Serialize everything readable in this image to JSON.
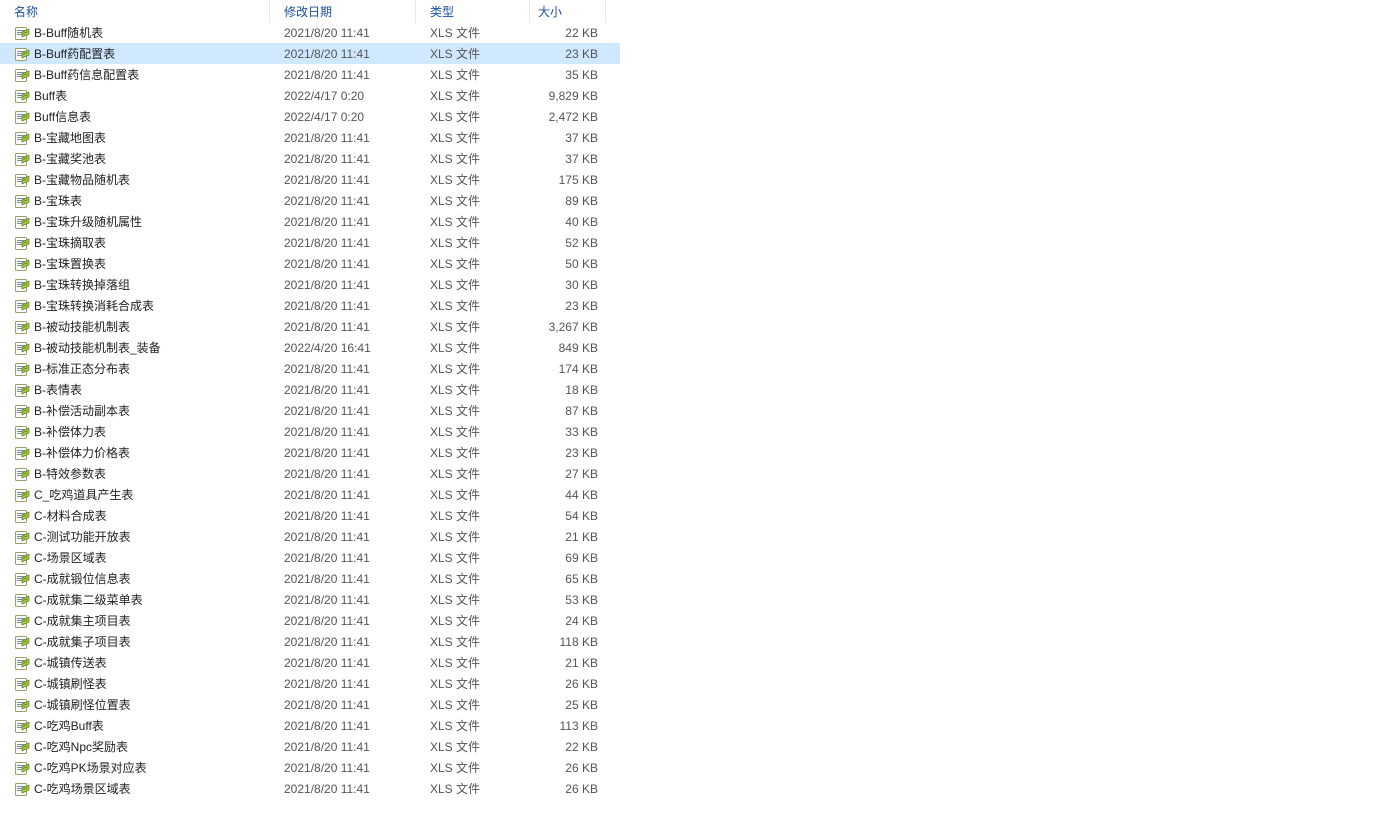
{
  "columns": {
    "name": "名称",
    "date": "修改日期",
    "type": "类型",
    "size": "大小"
  },
  "selected_index": 1,
  "rows": [
    {
      "name": "B-Buff随机表",
      "date": "2021/8/20 11:41",
      "type": "XLS 文件",
      "size": "22 KB"
    },
    {
      "name": "B-Buff药配置表",
      "date": "2021/8/20 11:41",
      "type": "XLS 文件",
      "size": "23 KB"
    },
    {
      "name": "B-Buff药信息配置表",
      "date": "2021/8/20 11:41",
      "type": "XLS 文件",
      "size": "35 KB"
    },
    {
      "name": "Buff表",
      "date": "2022/4/17 0:20",
      "type": "XLS 文件",
      "size": "9,829 KB"
    },
    {
      "name": "Buff信息表",
      "date": "2022/4/17 0:20",
      "type": "XLS 文件",
      "size": "2,472 KB"
    },
    {
      "name": "B-宝藏地图表",
      "date": "2021/8/20 11:41",
      "type": "XLS 文件",
      "size": "37 KB"
    },
    {
      "name": "B-宝藏奖池表",
      "date": "2021/8/20 11:41",
      "type": "XLS 文件",
      "size": "37 KB"
    },
    {
      "name": "B-宝藏物品随机表",
      "date": "2021/8/20 11:41",
      "type": "XLS 文件",
      "size": "175 KB"
    },
    {
      "name": "B-宝珠表",
      "date": "2021/8/20 11:41",
      "type": "XLS 文件",
      "size": "89 KB"
    },
    {
      "name": "B-宝珠升级随机属性",
      "date": "2021/8/20 11:41",
      "type": "XLS 文件",
      "size": "40 KB"
    },
    {
      "name": "B-宝珠摘取表",
      "date": "2021/8/20 11:41",
      "type": "XLS 文件",
      "size": "52 KB"
    },
    {
      "name": "B-宝珠置换表",
      "date": "2021/8/20 11:41",
      "type": "XLS 文件",
      "size": "50 KB"
    },
    {
      "name": "B-宝珠转换掉落组",
      "date": "2021/8/20 11:41",
      "type": "XLS 文件",
      "size": "30 KB"
    },
    {
      "name": "B-宝珠转换消耗合成表",
      "date": "2021/8/20 11:41",
      "type": "XLS 文件",
      "size": "23 KB"
    },
    {
      "name": "B-被动技能机制表",
      "date": "2021/8/20 11:41",
      "type": "XLS 文件",
      "size": "3,267 KB"
    },
    {
      "name": "B-被动技能机制表_装备",
      "date": "2022/4/20 16:41",
      "type": "XLS 文件",
      "size": "849 KB"
    },
    {
      "name": "B-标准正态分布表",
      "date": "2021/8/20 11:41",
      "type": "XLS 文件",
      "size": "174 KB"
    },
    {
      "name": "B-表情表",
      "date": "2021/8/20 11:41",
      "type": "XLS 文件",
      "size": "18 KB"
    },
    {
      "name": "B-补偿活动副本表",
      "date": "2021/8/20 11:41",
      "type": "XLS 文件",
      "size": "87 KB"
    },
    {
      "name": "B-补偿体力表",
      "date": "2021/8/20 11:41",
      "type": "XLS 文件",
      "size": "33 KB"
    },
    {
      "name": "B-补偿体力价格表",
      "date": "2021/8/20 11:41",
      "type": "XLS 文件",
      "size": "23 KB"
    },
    {
      "name": "B-特效参数表",
      "date": "2021/8/20 11:41",
      "type": "XLS 文件",
      "size": "27 KB"
    },
    {
      "name": "C_吃鸡道具产生表",
      "date": "2021/8/20 11:41",
      "type": "XLS 文件",
      "size": "44 KB"
    },
    {
      "name": "C-材料合成表",
      "date": "2021/8/20 11:41",
      "type": "XLS 文件",
      "size": "54 KB"
    },
    {
      "name": "C-测试功能开放表",
      "date": "2021/8/20 11:41",
      "type": "XLS 文件",
      "size": "21 KB"
    },
    {
      "name": "C-场景区域表",
      "date": "2021/8/20 11:41",
      "type": "XLS 文件",
      "size": "69 KB"
    },
    {
      "name": "C-成就锻位信息表",
      "date": "2021/8/20 11:41",
      "type": "XLS 文件",
      "size": "65 KB"
    },
    {
      "name": "C-成就集二级菜单表",
      "date": "2021/8/20 11:41",
      "type": "XLS 文件",
      "size": "53 KB"
    },
    {
      "name": "C-成就集主项目表",
      "date": "2021/8/20 11:41",
      "type": "XLS 文件",
      "size": "24 KB"
    },
    {
      "name": "C-成就集子项目表",
      "date": "2021/8/20 11:41",
      "type": "XLS 文件",
      "size": "118 KB"
    },
    {
      "name": "C-城镇传送表",
      "date": "2021/8/20 11:41",
      "type": "XLS 文件",
      "size": "21 KB"
    },
    {
      "name": "C-城镇刷怪表",
      "date": "2021/8/20 11:41",
      "type": "XLS 文件",
      "size": "26 KB"
    },
    {
      "name": "C-城镇刷怪位置表",
      "date": "2021/8/20 11:41",
      "type": "XLS 文件",
      "size": "25 KB"
    },
    {
      "name": "C-吃鸡Buff表",
      "date": "2021/8/20 11:41",
      "type": "XLS 文件",
      "size": "113 KB"
    },
    {
      "name": "C-吃鸡Npc奖励表",
      "date": "2021/8/20 11:41",
      "type": "XLS 文件",
      "size": "22 KB"
    },
    {
      "name": "C-吃鸡PK场景对应表",
      "date": "2021/8/20 11:41",
      "type": "XLS 文件",
      "size": "26 KB"
    },
    {
      "name": "C-吃鸡场景区域表",
      "date": "2021/8/20 11:41",
      "type": "XLS 文件",
      "size": "26 KB"
    }
  ]
}
